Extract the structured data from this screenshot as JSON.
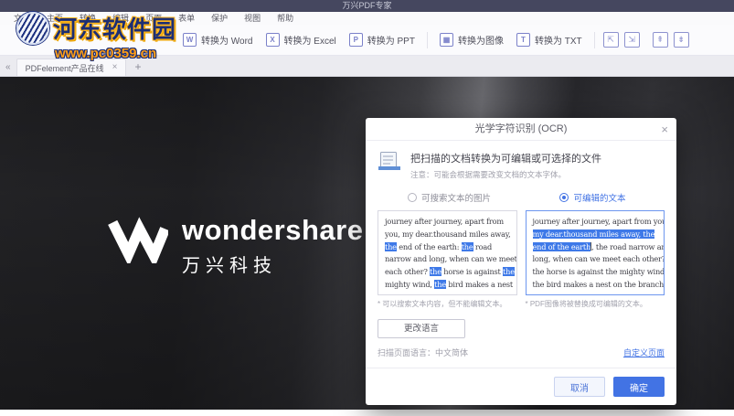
{
  "titlebar": {
    "title": "万兴PDF专家"
  },
  "watermark": {
    "site": "河东软件园",
    "url": "www.pc0359.cn"
  },
  "menu": {
    "items": [
      "文件",
      "主页",
      "转换",
      "编辑",
      "页面",
      "表单",
      "保护",
      "视图",
      "帮助"
    ]
  },
  "toolbar": {
    "buttons": [
      {
        "label": "转换为 Word",
        "glyph": "W"
      },
      {
        "label": "转换为 Excel",
        "glyph": "X"
      },
      {
        "label": "转换为 PPT",
        "glyph": "P"
      },
      {
        "label": "转换为图像",
        "glyph": "▦"
      },
      {
        "label": "转换为 TXT",
        "glyph": "T"
      }
    ],
    "extra_glyphs": [
      "⇱",
      "⇲",
      "⇞",
      "⇟"
    ]
  },
  "tabbar": {
    "collapse": "«",
    "active_tab": "PDFelement产品在线",
    "close": "×",
    "new_tab": "+"
  },
  "hero": {
    "brand_en": "wondershare",
    "brand_cn": "万兴科技"
  },
  "dialog": {
    "title": "光学字符识别 (OCR)",
    "close": "×",
    "headline": "把扫描的文档转换为可编辑或可选择的文件",
    "note": "注意：可能会根据需要改变文档的文本字体。",
    "option_searchable": "可搜索文本的图片",
    "option_editable": "可编辑的文本",
    "preview_left": {
      "lines": [
        [
          {
            "t": "journey after journey, apart from"
          }
        ],
        [
          {
            "t": "you, my dear.thousand miles away,"
          }
        ],
        [
          {
            "t": "the",
            "hl": true
          },
          {
            "t": " end of the earth: "
          },
          {
            "t": "the",
            "hl": true
          },
          {
            "t": " road"
          }
        ],
        [
          {
            "t": "narrow and long, when can we meet"
          }
        ],
        [
          {
            "t": "each other? "
          },
          {
            "t": "the",
            "hl": true
          },
          {
            "t": " horse is against "
          },
          {
            "t": "the",
            "hl": true
          }
        ],
        [
          {
            "t": "mighty wind, "
          },
          {
            "t": "the",
            "hl": true
          },
          {
            "t": " bird makes a nest"
          }
        ]
      ]
    },
    "preview_right": {
      "lines": [
        [
          {
            "t": "journey after journey, apart from you,"
          }
        ],
        [
          {
            "t": "my dear.thousand miles away, the",
            "hl": true
          }
        ],
        [
          {
            "t": "end of the earth",
            "hl": true
          },
          {
            "caret": true
          },
          {
            "t": ", the road narrow and"
          }
        ],
        [
          {
            "t": "long, when can we meet each other?"
          }
        ],
        [
          {
            "t": "the horse is against the mighty wind,"
          }
        ],
        [
          {
            "t": "the bird makes a nest on the branch-"
          }
        ]
      ]
    },
    "footnote_left": "* 可以搜索文本内容，但不能编辑文本。",
    "footnote_right": "* PDF图像将被替换成可编辑的文本。",
    "change_language": "更改语言",
    "language_label": "扫描页面语言：中文简体",
    "custom_pages": "自定义页面",
    "cancel": "取消",
    "confirm": "确定"
  }
}
